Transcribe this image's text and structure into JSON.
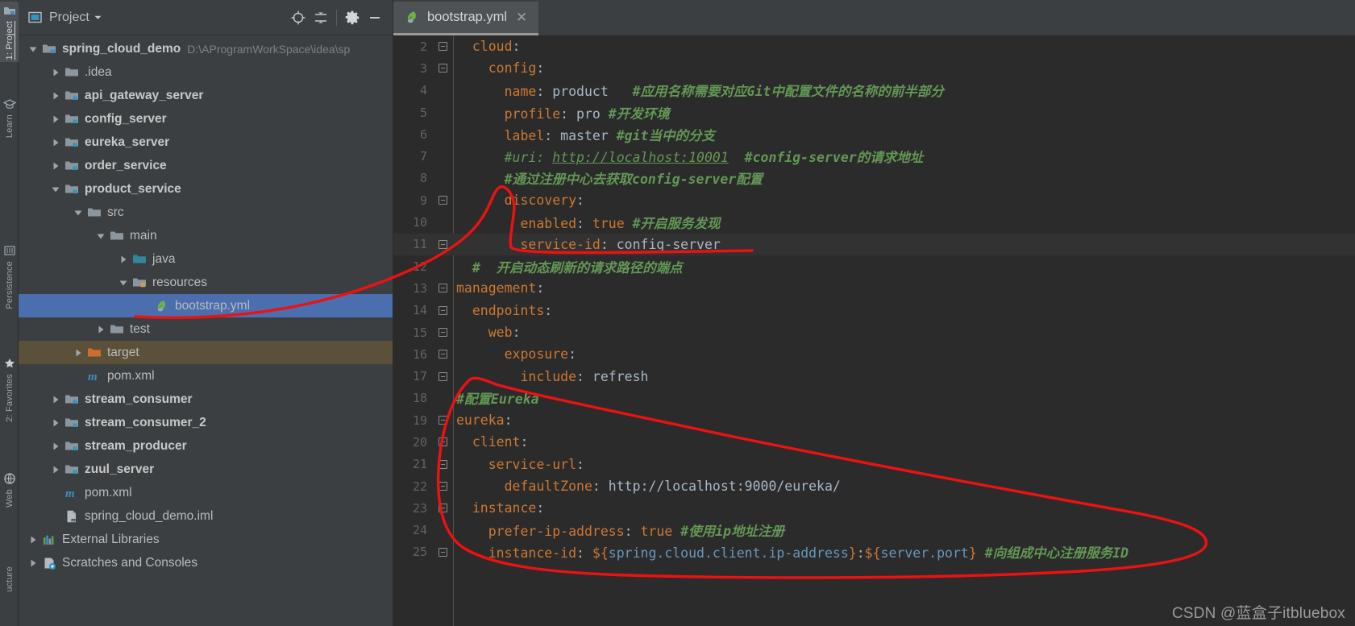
{
  "toolwindow_tabs": [
    {
      "label": "1: Project",
      "icon": "project-icon",
      "active": true
    },
    {
      "label": "Learn",
      "icon": "learn-icon",
      "active": false
    },
    {
      "label": "Persistence",
      "icon": "persistence-icon",
      "active": false
    },
    {
      "label": "2: Favorites",
      "icon": "star-icon",
      "active": false
    },
    {
      "label": "Web",
      "icon": "globe-icon",
      "active": false
    },
    {
      "label": "ucture",
      "icon": "structure-icon",
      "active": false
    }
  ],
  "panel": {
    "title": "Project",
    "icon": "project-view-icon",
    "dropdown_icon": "chevron-down-icon",
    "actions": [
      {
        "name": "locate-icon",
        "title": "Select Opened File"
      },
      {
        "name": "collapse-all-icon",
        "title": "Collapse All"
      },
      {
        "name": "gear-icon",
        "title": "Settings"
      },
      {
        "name": "hide-icon",
        "title": "Hide"
      }
    ]
  },
  "tree": [
    {
      "label": "spring_cloud_demo",
      "path": "D:\\AProgramWorkSpace\\idea\\sp",
      "indent": 0,
      "arrow": "down",
      "icon": "module-folder-icon",
      "bold": true
    },
    {
      "label": ".idea",
      "indent": 1,
      "arrow": "right",
      "icon": "folder-icon",
      "bold": false
    },
    {
      "label": "api_gateway_server",
      "indent": 1,
      "arrow": "right",
      "icon": "module-folder-icon",
      "bold": true
    },
    {
      "label": "config_server",
      "indent": 1,
      "arrow": "right",
      "icon": "module-folder-icon",
      "bold": true
    },
    {
      "label": "eureka_server",
      "indent": 1,
      "arrow": "right",
      "icon": "module-folder-icon",
      "bold": true
    },
    {
      "label": "order_service",
      "indent": 1,
      "arrow": "right",
      "icon": "module-folder-icon",
      "bold": true
    },
    {
      "label": "product_service",
      "indent": 1,
      "arrow": "down",
      "icon": "module-folder-icon",
      "bold": true
    },
    {
      "label": "src",
      "indent": 2,
      "arrow": "down",
      "icon": "folder-icon",
      "bold": false
    },
    {
      "label": "main",
      "indent": 3,
      "arrow": "down",
      "icon": "folder-icon",
      "bold": false
    },
    {
      "label": "java",
      "indent": 4,
      "arrow": "right",
      "icon": "source-folder-icon",
      "bold": false
    },
    {
      "label": "resources",
      "indent": 4,
      "arrow": "down",
      "icon": "resources-folder-icon",
      "bold": false
    },
    {
      "label": "bootstrap.yml",
      "indent": 5,
      "arrow": "none",
      "icon": "spring-yml-icon",
      "bold": false,
      "state": "selected"
    },
    {
      "label": "test",
      "indent": 3,
      "arrow": "right",
      "icon": "folder-icon",
      "bold": false
    },
    {
      "label": "target",
      "indent": 2,
      "arrow": "right",
      "icon": "excluded-folder-icon",
      "bold": false,
      "state": "excluded"
    },
    {
      "label": "pom.xml",
      "indent": 2,
      "arrow": "none",
      "icon": "maven-icon",
      "bold": false
    },
    {
      "label": "stream_consumer",
      "indent": 1,
      "arrow": "right",
      "icon": "module-folder-icon",
      "bold": true
    },
    {
      "label": "stream_consumer_2",
      "indent": 1,
      "arrow": "right",
      "icon": "module-folder-icon",
      "bold": true
    },
    {
      "label": "stream_producer",
      "indent": 1,
      "arrow": "right",
      "icon": "module-folder-icon",
      "bold": true
    },
    {
      "label": "zuul_server",
      "indent": 1,
      "arrow": "right",
      "icon": "module-folder-icon",
      "bold": true
    },
    {
      "label": "pom.xml",
      "indent": 1,
      "arrow": "none",
      "icon": "maven-icon",
      "bold": false
    },
    {
      "label": "spring_cloud_demo.iml",
      "indent": 1,
      "arrow": "none",
      "icon": "iml-icon",
      "bold": false
    },
    {
      "label": "External Libraries",
      "indent": 0,
      "arrow": "right",
      "icon": "libraries-icon",
      "bold": false
    },
    {
      "label": "Scratches and Consoles",
      "indent": 0,
      "arrow": "right",
      "icon": "scratches-icon",
      "bold": false
    }
  ],
  "editor": {
    "tab": {
      "label": "bootstrap.yml",
      "icon": "spring-yml-icon",
      "close_icon": "close-icon"
    },
    "caret_line": 11,
    "lines": [
      {
        "n": 2,
        "fold": true,
        "indent": 1,
        "tokens": [
          {
            "t": "cloud",
            "c": "k"
          },
          {
            "t": ":",
            "c": "punc"
          }
        ]
      },
      {
        "n": 3,
        "fold": true,
        "indent": 2,
        "tokens": [
          {
            "t": "config",
            "c": "k"
          },
          {
            "t": ":",
            "c": "punc"
          }
        ]
      },
      {
        "n": 4,
        "fold": false,
        "indent": 3,
        "tokens": [
          {
            "t": "name",
            "c": "k"
          },
          {
            "t": ": ",
            "c": "punc"
          },
          {
            "t": "product",
            "c": "v"
          },
          {
            "t": "   ",
            "c": "v"
          },
          {
            "t": "#应用名称需要对应Git中配置文件的名称的前半部分",
            "c": "cb"
          }
        ]
      },
      {
        "n": 5,
        "fold": false,
        "indent": 3,
        "tokens": [
          {
            "t": "profile",
            "c": "k"
          },
          {
            "t": ": ",
            "c": "punc"
          },
          {
            "t": "pro",
            "c": "v"
          },
          {
            "t": " ",
            "c": "v"
          },
          {
            "t": "#开发环境",
            "c": "cb"
          }
        ]
      },
      {
        "n": 6,
        "fold": false,
        "indent": 3,
        "tokens": [
          {
            "t": "label",
            "c": "k"
          },
          {
            "t": ": ",
            "c": "punc"
          },
          {
            "t": "master",
            "c": "v"
          },
          {
            "t": " ",
            "c": "v"
          },
          {
            "t": "#git当中的分支",
            "c": "cb"
          }
        ]
      },
      {
        "n": 7,
        "fold": false,
        "indent": 3,
        "tokens": [
          {
            "t": "#uri: ",
            "c": "c"
          },
          {
            "t": "http://localhost:10001",
            "c": "u"
          },
          {
            "t": "  ",
            "c": "c"
          },
          {
            "t": "#config-server的请求地址",
            "c": "cb"
          }
        ]
      },
      {
        "n": 8,
        "fold": false,
        "indent": 3,
        "tokens": [
          {
            "t": "#通过注册中心去获取config-server配置",
            "c": "cb"
          }
        ]
      },
      {
        "n": 9,
        "fold": true,
        "indent": 3,
        "tokens": [
          {
            "t": "discovery",
            "c": "k"
          },
          {
            "t": ":",
            "c": "punc"
          }
        ]
      },
      {
        "n": 10,
        "fold": false,
        "indent": 4,
        "tokens": [
          {
            "t": "enabled",
            "c": "k"
          },
          {
            "t": ": ",
            "c": "punc"
          },
          {
            "t": "true",
            "c": "k"
          },
          {
            "t": " ",
            "c": "v"
          },
          {
            "t": "#开启服务发现",
            "c": "cb"
          }
        ]
      },
      {
        "n": 11,
        "fold": true,
        "indent": 4,
        "tokens": [
          {
            "t": "service-id",
            "c": "k"
          },
          {
            "t": ": ",
            "c": "punc"
          },
          {
            "t": "config-server",
            "c": "v"
          }
        ]
      },
      {
        "n": 12,
        "fold": false,
        "indent": 1,
        "tokens": [
          {
            "t": "#  开启动态刷新的请求路径的端点",
            "c": "cb"
          }
        ]
      },
      {
        "n": 13,
        "fold": true,
        "indent": 0,
        "tokens": [
          {
            "t": "management",
            "c": "k"
          },
          {
            "t": ":",
            "c": "punc"
          }
        ]
      },
      {
        "n": 14,
        "fold": true,
        "indent": 1,
        "tokens": [
          {
            "t": "endpoints",
            "c": "k"
          },
          {
            "t": ":",
            "c": "punc"
          }
        ]
      },
      {
        "n": 15,
        "fold": true,
        "indent": 2,
        "tokens": [
          {
            "t": "web",
            "c": "k"
          },
          {
            "t": ":",
            "c": "punc"
          }
        ]
      },
      {
        "n": 16,
        "fold": true,
        "indent": 3,
        "tokens": [
          {
            "t": "exposure",
            "c": "k"
          },
          {
            "t": ":",
            "c": "punc"
          }
        ]
      },
      {
        "n": 17,
        "fold": true,
        "indent": 4,
        "tokens": [
          {
            "t": "include",
            "c": "k"
          },
          {
            "t": ": ",
            "c": "punc"
          },
          {
            "t": "refresh",
            "c": "v"
          }
        ]
      },
      {
        "n": 18,
        "fold": false,
        "indent": 0,
        "tokens": [
          {
            "t": "#配置Eureka",
            "c": "cb"
          }
        ]
      },
      {
        "n": 19,
        "fold": true,
        "indent": 0,
        "tokens": [
          {
            "t": "eureka",
            "c": "k"
          },
          {
            "t": ":",
            "c": "punc"
          }
        ]
      },
      {
        "n": 20,
        "fold": true,
        "indent": 1,
        "tokens": [
          {
            "t": "client",
            "c": "k"
          },
          {
            "t": ":",
            "c": "punc"
          }
        ]
      },
      {
        "n": 21,
        "fold": true,
        "indent": 2,
        "tokens": [
          {
            "t": "service-url",
            "c": "k"
          },
          {
            "t": ":",
            "c": "punc"
          }
        ]
      },
      {
        "n": 22,
        "fold": true,
        "indent": 3,
        "tokens": [
          {
            "t": "defaultZone",
            "c": "k"
          },
          {
            "t": ": ",
            "c": "punc"
          },
          {
            "t": "http://localhost:9000/eureka/",
            "c": "v"
          }
        ]
      },
      {
        "n": 23,
        "fold": true,
        "indent": 1,
        "tokens": [
          {
            "t": "instance",
            "c": "k"
          },
          {
            "t": ":",
            "c": "punc"
          }
        ]
      },
      {
        "n": 24,
        "fold": false,
        "indent": 2,
        "tokens": [
          {
            "t": "prefer-ip-address",
            "c": "k"
          },
          {
            "t": ": ",
            "c": "punc"
          },
          {
            "t": "true",
            "c": "k"
          },
          {
            "t": " ",
            "c": "v"
          },
          {
            "t": "#使用ip地址注册",
            "c": "cb"
          }
        ]
      },
      {
        "n": 25,
        "fold": true,
        "indent": 2,
        "tokens": [
          {
            "t": "instance-id",
            "c": "k"
          },
          {
            "t": ": ",
            "c": "punc"
          },
          {
            "t": "${",
            "c": "k"
          },
          {
            "t": "spring.cloud.client.ip-address",
            "c": "num"
          },
          {
            "t": "}",
            "c": "k"
          },
          {
            "t": ":",
            "c": "punc"
          },
          {
            "t": "${",
            "c": "k"
          },
          {
            "t": "server.port",
            "c": "num"
          },
          {
            "t": "}",
            "c": "k"
          },
          {
            "t": " ",
            "c": "v"
          },
          {
            "t": "#向组成中心注册服务ID",
            "c": "cb"
          }
        ]
      }
    ]
  },
  "watermark": "CSDN @蓝盒子itbluebox",
  "colors": {
    "selection": "#4b6eaf",
    "excluded": "#5b513a",
    "annotation": "#ee1111",
    "panel_bg": "#3c3f41",
    "editor_bg": "#2b2b2b",
    "key": "#cc7832",
    "comment": "#629755",
    "value": "#a9b7c6"
  }
}
